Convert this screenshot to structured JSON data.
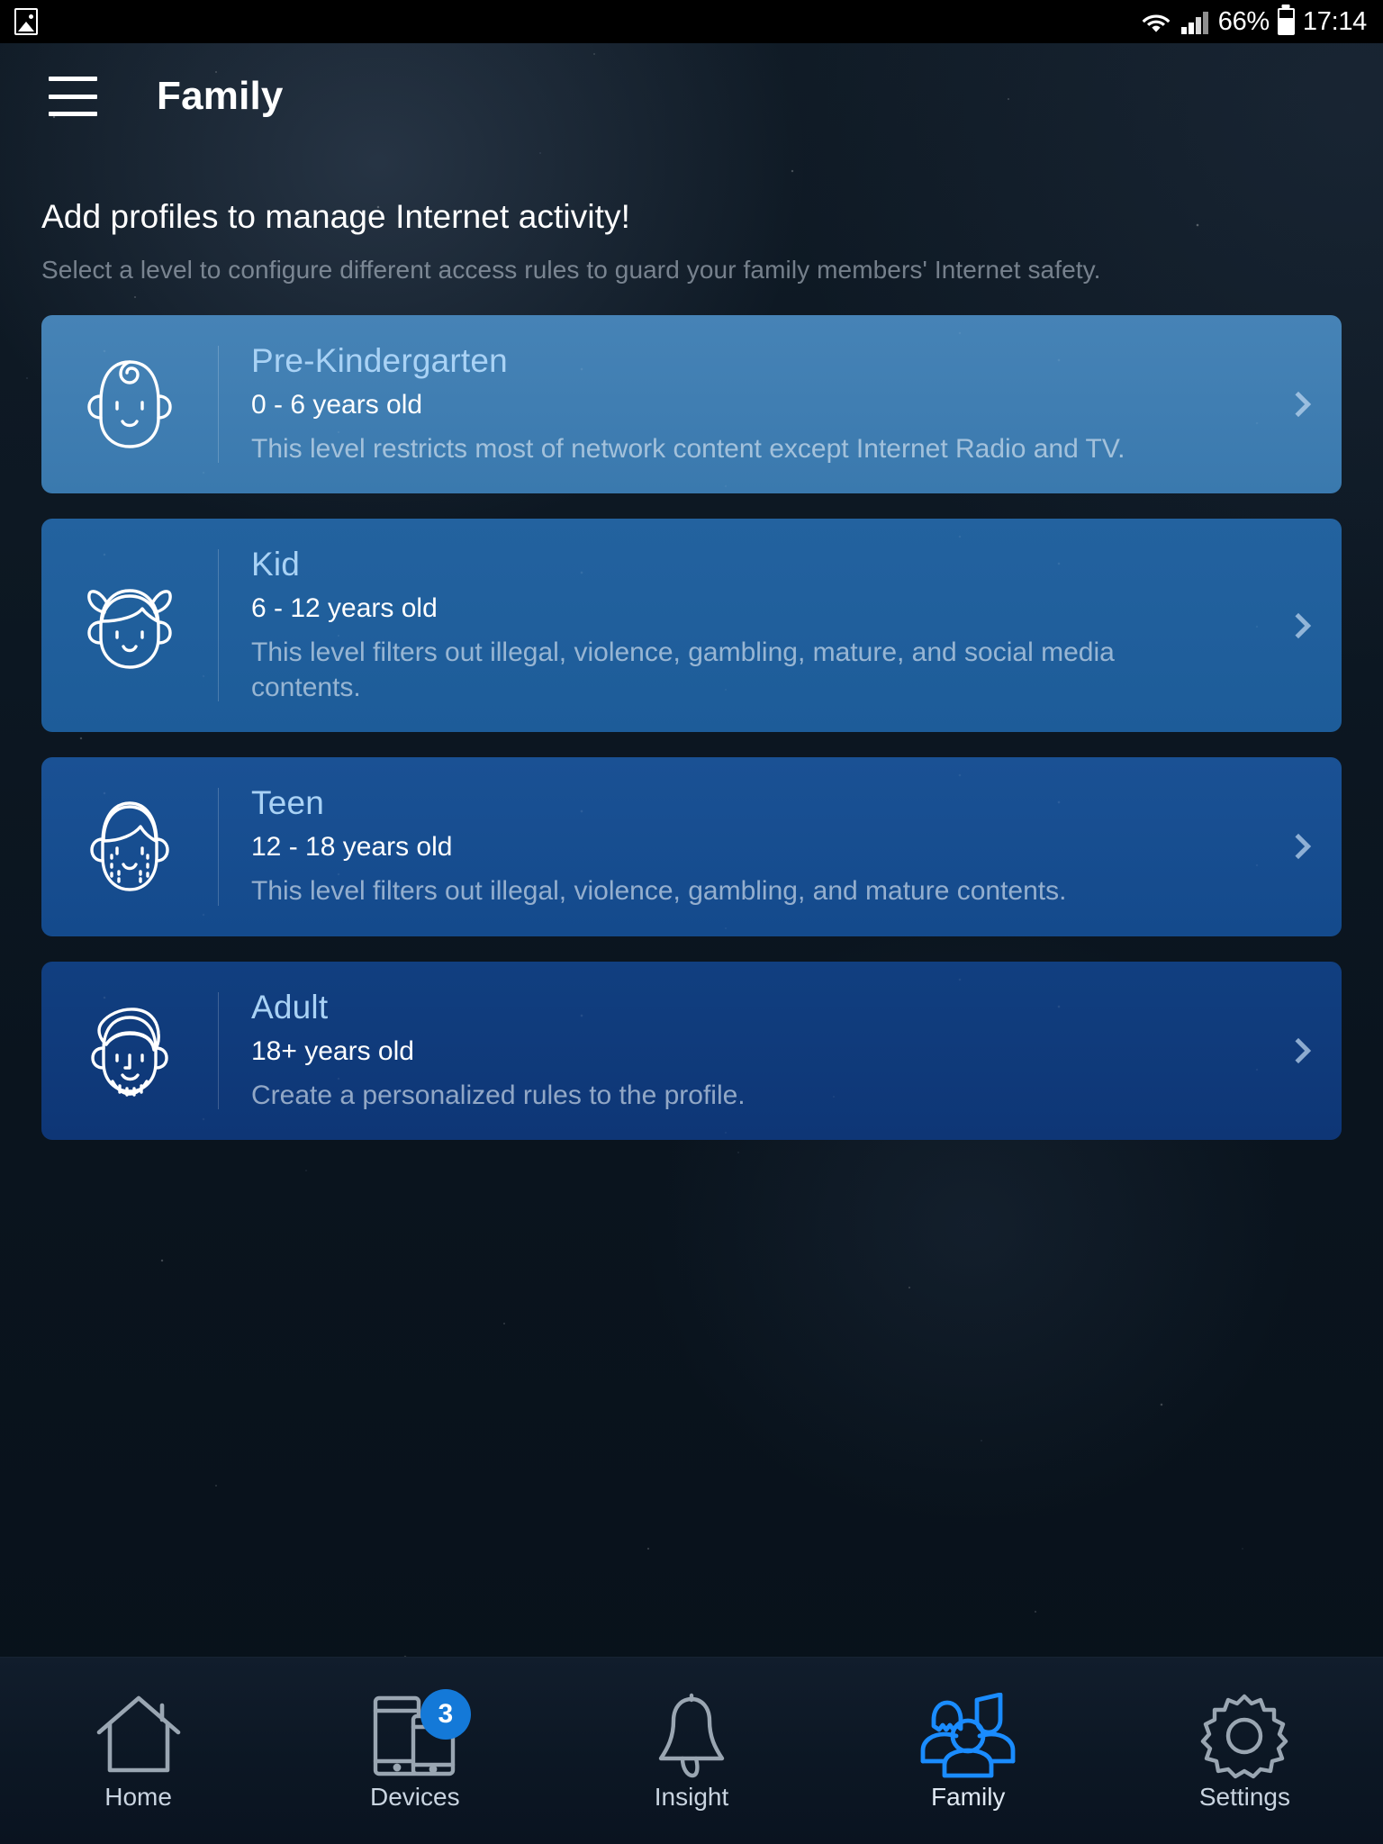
{
  "status_bar": {
    "left_icon": "gallery-icon",
    "wifi_icon": "wifi-icon",
    "signal_icon": "cellular-signal-icon",
    "battery_percent": "66%",
    "battery_icon": "battery-icon",
    "time": "17:14"
  },
  "toolbar": {
    "menu_icon": "hamburger-menu-icon",
    "title": "Family"
  },
  "intro": {
    "title": "Add profiles to manage Internet activity!",
    "subtitle": "Select a level to configure different access rules to guard your family members' Internet safety."
  },
  "profiles": [
    {
      "id": "pre-kindergarten",
      "title": "Pre-Kindergarten",
      "age": "0 - 6 years old",
      "description": "This level restricts most of network content except Internet Radio and TV.",
      "icon": "baby-face-icon",
      "color": "#3a79ae",
      "chevron_icon": "chevron-right-icon"
    },
    {
      "id": "kid",
      "title": "Kid",
      "age": "6 - 12 years old",
      "description": "This level filters out illegal, violence, gambling, mature, and social media contents.",
      "icon": "girl-face-icon",
      "color": "#1d5c99",
      "chevron_icon": "chevron-right-icon"
    },
    {
      "id": "teen",
      "title": "Teen",
      "age": "12 - 18 years old",
      "description": "This level filters out illegal, violence, gambling, and mature contents.",
      "icon": "teen-face-icon",
      "color": "#144a8c",
      "chevron_icon": "chevron-right-icon"
    },
    {
      "id": "adult",
      "title": "Adult",
      "age": "18+ years old",
      "description": "Create a personalized rules to the profile.",
      "icon": "adult-face-icon",
      "color": "#0e3676",
      "chevron_icon": "chevron-right-icon"
    }
  ],
  "bottom_nav": {
    "active": "Family",
    "accent_color": "#1a8cff",
    "items": [
      {
        "label": "Home",
        "icon": "home-icon",
        "badge": ""
      },
      {
        "label": "Devices",
        "icon": "devices-icon",
        "badge": "3"
      },
      {
        "label": "Insight",
        "icon": "bell-icon",
        "badge": ""
      },
      {
        "label": "Family",
        "icon": "family-group-icon",
        "badge": ""
      },
      {
        "label": "Settings",
        "icon": "gear-icon",
        "badge": ""
      }
    ]
  }
}
